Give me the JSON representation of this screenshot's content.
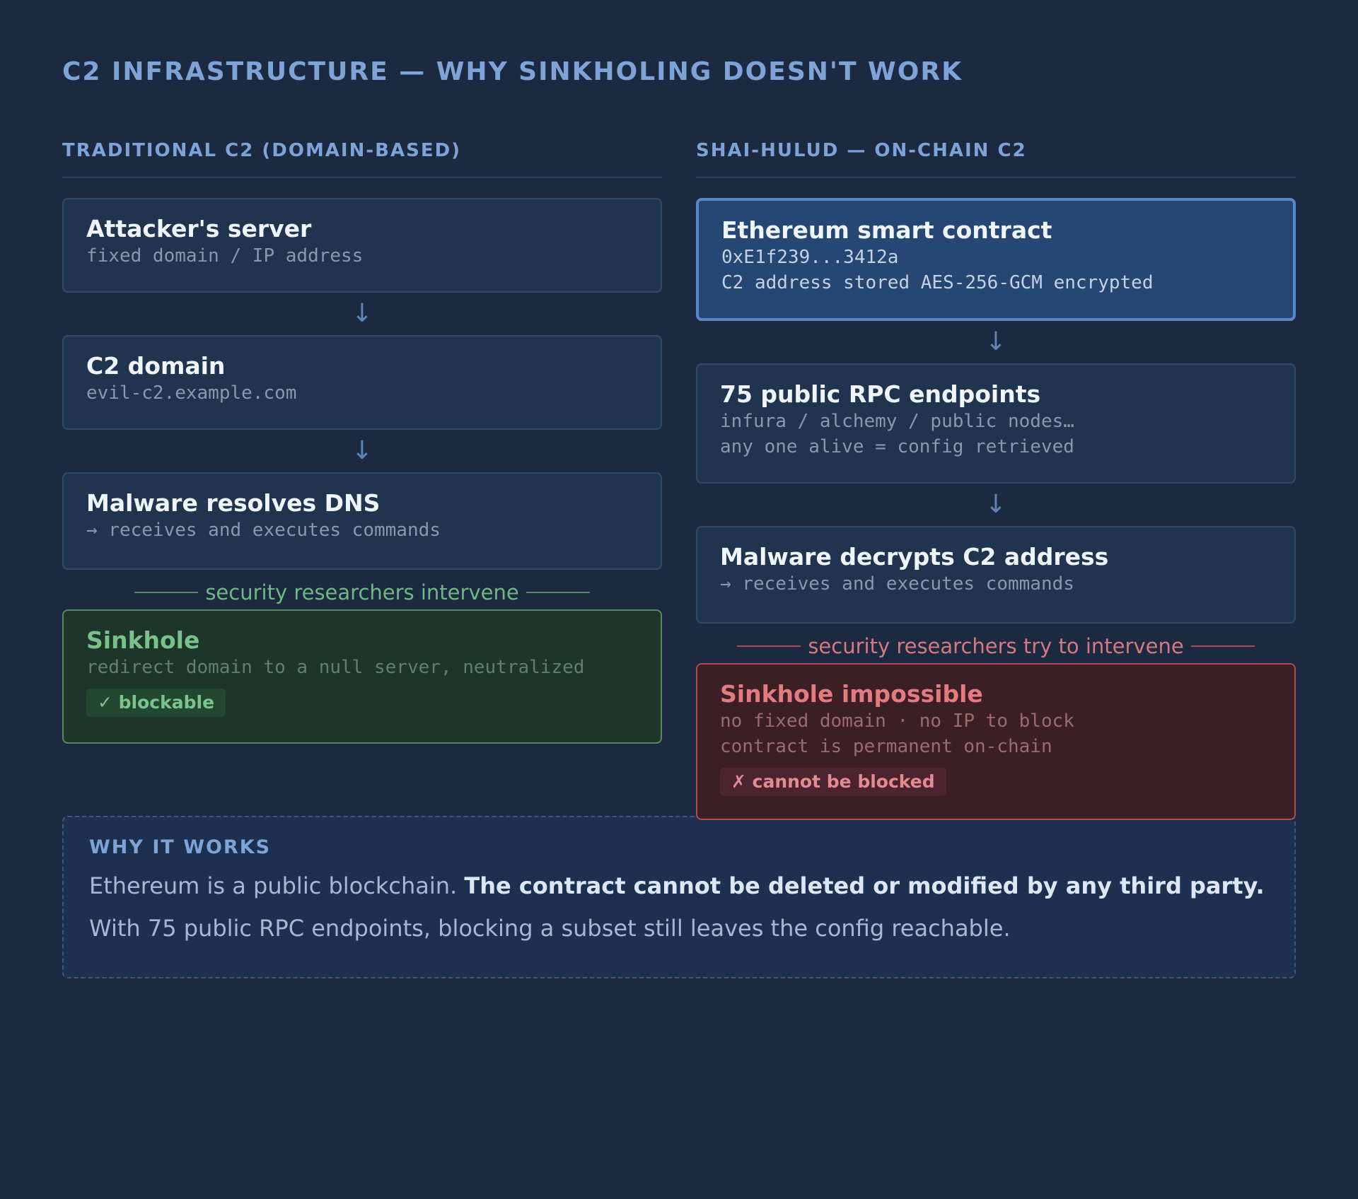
{
  "title": "C2 INFRASTRUCTURE — WHY SINKHOLING DOESN'T WORK",
  "left": {
    "header": "TRADITIONAL C2 (DOMAIN-BASED)",
    "nodes": [
      {
        "title": "Attacker's server",
        "lines": [
          "fixed domain / IP address"
        ]
      },
      {
        "title": "C2 domain",
        "lines": [
          "evil-c2.example.com"
        ]
      },
      {
        "title": "Malware resolves DNS",
        "lines": [
          "→ receives and executes commands"
        ]
      }
    ],
    "divider": "security researchers intervene",
    "outcome": {
      "title": "Sinkhole",
      "lines": [
        "redirect domain to a null server, neutralized"
      ],
      "badge": "✓ blockable"
    }
  },
  "right": {
    "header": "SHAI-HULUD — ON-CHAIN C2",
    "nodes": [
      {
        "title": "Ethereum smart contract",
        "lines": [
          "0xE1f239...3412a",
          "C2 address stored AES-256-GCM encrypted"
        ]
      },
      {
        "title": "75 public RPC endpoints",
        "lines": [
          "infura / alchemy / public nodes…",
          "any one alive = config retrieved"
        ]
      },
      {
        "title": "Malware decrypts C2 address",
        "lines": [
          "→ receives and executes commands"
        ]
      }
    ],
    "divider": "security researchers try to intervene",
    "outcome": {
      "title": "Sinkhole impossible",
      "lines": [
        "no fixed domain · no IP to block",
        "contract is permanent on-chain"
      ],
      "badge": "✗ cannot be blocked"
    }
  },
  "arrow_glyph": "↓",
  "why": {
    "title": "WHY IT WORKS",
    "line1_plain": "Ethereum is a public blockchain. ",
    "line1_bold": "The contract cannot be deleted or modified by any third party.",
    "line2": "With 75 public RPC endpoints, blocking a subset still leaves the config reachable."
  },
  "colors": {
    "background": "#1b2a41",
    "accent": "#7ea3d6",
    "success": "#79c08b",
    "danger": "#e37b80"
  }
}
